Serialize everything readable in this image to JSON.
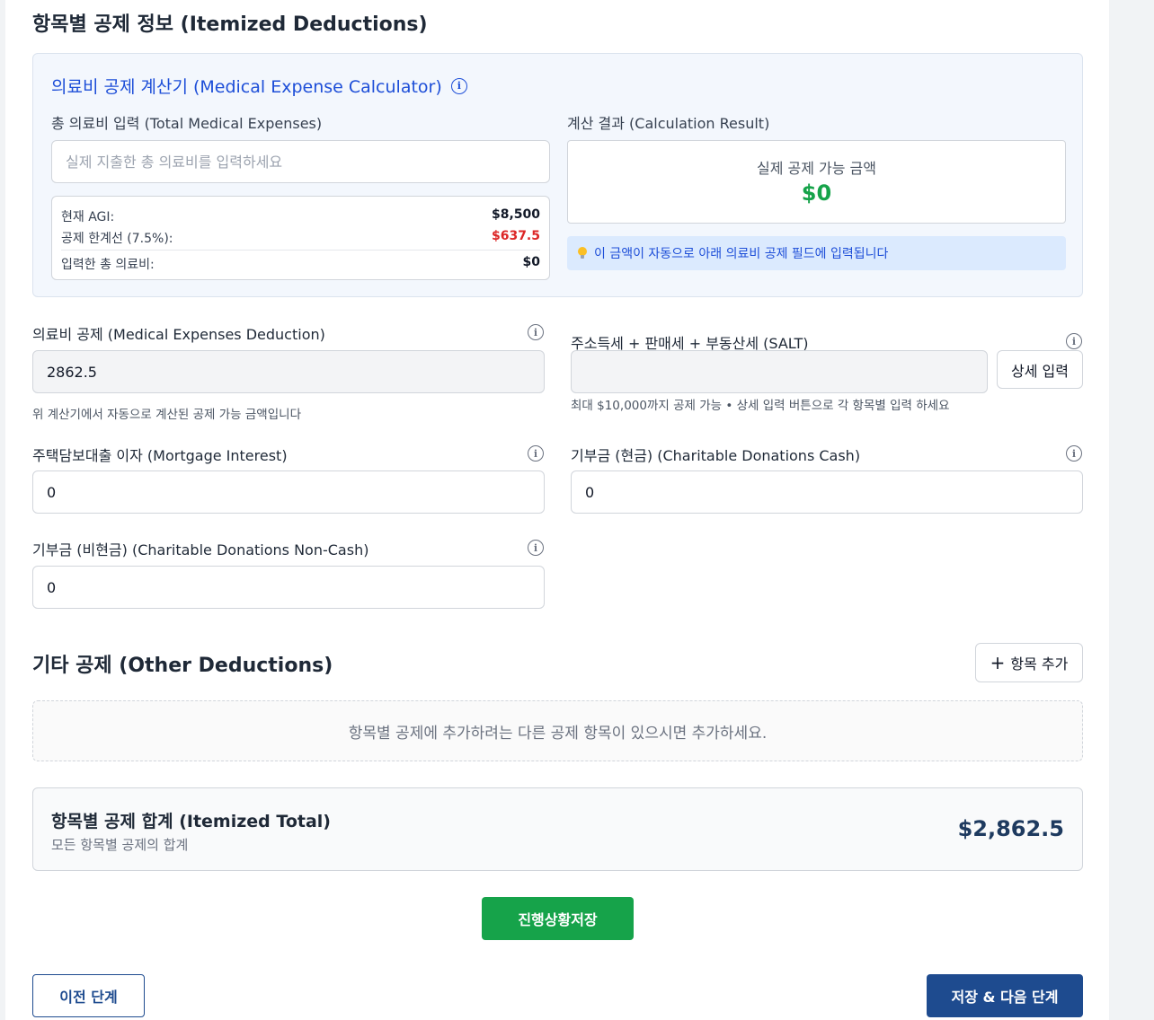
{
  "section_title": "항목별 공제 정보 (Itemized Deductions)",
  "calculator": {
    "title": "의료비 공제 계산기 (Medical Expense Calculator)",
    "total_label": "총 의료비 입력 (Total Medical Expenses)",
    "total_placeholder": "실제 지출한 총 의료비를 입력하세요",
    "total_value": "",
    "agi_label": "현재 AGI:",
    "agi_value": "$8,500",
    "threshold_label": "공제 한계선 (7.5%):",
    "threshold_value": "$637.5",
    "entered_label": "입력한 총 의료비:",
    "entered_value": "$0",
    "result_label": "계산 결과 (Calculation Result)",
    "result_caption": "실제 공제 가능 금액",
    "result_value": "$0",
    "hint": "이 금액이 자동으로 아래 의료비 공제 필드에 입력됩니다"
  },
  "fields": {
    "medical_label": "의료비 공제 (Medical Expenses Deduction)",
    "medical_value": "2862.5",
    "medical_help": "위 계산기에서 자동으로 계산된 공제 가능 금액입니다",
    "salt_label": "주소득세 + 판매세 + 부동산세 (SALT)",
    "salt_value": "",
    "salt_button": "상세 입력",
    "salt_help": "최대 $10,000까지 공제 가능 • 상세 입력 버튼으로 각 항목별 입력 하세요",
    "mortgage_label": "주택담보대출 이자 (Mortgage Interest)",
    "mortgage_value": "0",
    "donation_cash_label": "기부금 (현금) (Charitable Donations Cash)",
    "donation_cash_value": "0",
    "donation_noncash_label": "기부금 (비현금) (Charitable Donations Non-Cash)",
    "donation_noncash_value": "0"
  },
  "other": {
    "title": "기타 공제 (Other Deductions)",
    "add_button": "항목 추가",
    "empty_message": "항목별 공제에 추가하려는 다른 공제 항목이 있으시면 추가하세요."
  },
  "total": {
    "title": "항목별 공제 합계 (Itemized Total)",
    "subtitle": "모든 항목별 공제의 합계",
    "value": "$2,862.5"
  },
  "buttons": {
    "save_progress": "진행상황저장",
    "previous": "이전 단계",
    "save_next": "저장 & 다음 단계"
  },
  "colors": {
    "accent_blue": "#1d4ed8",
    "navy": "#1e4b8f",
    "green": "#16a34a",
    "red": "#dc2626"
  },
  "icons": {
    "info": "info-icon",
    "bulb": "lightbulb-icon",
    "plus": "plus-icon"
  }
}
